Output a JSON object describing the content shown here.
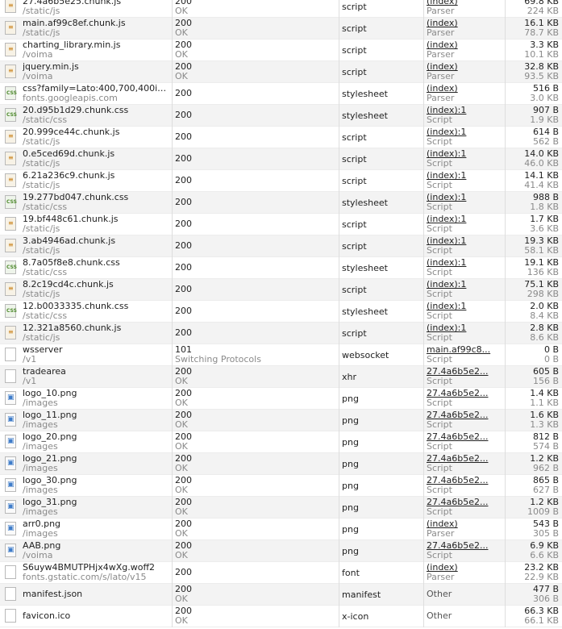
{
  "rows": [
    {
      "name": "27.4a6b5e25.chunk.js",
      "path": "/static/js",
      "status": "200",
      "status_text": "OK",
      "type": "script",
      "initiator": "(index)",
      "initiator_sub": "Parser",
      "size": "69.8 KB",
      "size_sub": "224 KB",
      "icon": "script-file-icon"
    },
    {
      "name": "main.af99c8ef.chunk.js",
      "path": "/static/js",
      "status": "200",
      "status_text": "OK",
      "type": "script",
      "initiator": "(index)",
      "initiator_sub": "Parser",
      "size": "16.1 KB",
      "size_sub": "78.7 KB",
      "icon": "script-file-icon"
    },
    {
      "name": "charting_library.min.js",
      "path": "/voima",
      "status": "200",
      "status_text": "OK",
      "type": "script",
      "initiator": "(index)",
      "initiator_sub": "Parser",
      "size": "3.3 KB",
      "size_sub": "10.1 KB",
      "icon": "script-file-icon"
    },
    {
      "name": "jquery.min.js",
      "path": "/voima",
      "status": "200",
      "status_text": "OK",
      "type": "script",
      "initiator": "(index)",
      "initiator_sub": "Parser",
      "size": "32.8 KB",
      "size_sub": "93.5 KB",
      "icon": "script-file-icon"
    },
    {
      "name": "css?family=Lato:400,700,400itali...",
      "path": "fonts.googleapis.com",
      "status": "200",
      "status_text": "",
      "type": "stylesheet",
      "initiator": "(index)",
      "initiator_sub": "Parser",
      "size": "516 B",
      "size_sub": "3.0 KB",
      "icon": "css-file-icon"
    },
    {
      "name": "20.d95b1d29.chunk.css",
      "path": "/static/css",
      "status": "200",
      "status_text": "",
      "type": "stylesheet",
      "initiator": "(index):1",
      "initiator_sub": "Script",
      "size": "907 B",
      "size_sub": "1.9 KB",
      "icon": "css-file-icon"
    },
    {
      "name": "20.999ce44c.chunk.js",
      "path": "/static/js",
      "status": "200",
      "status_text": "",
      "type": "script",
      "initiator": "(index):1",
      "initiator_sub": "Script",
      "size": "614 B",
      "size_sub": "562 B",
      "icon": "script-file-icon"
    },
    {
      "name": "0.e5ced69d.chunk.js",
      "path": "/static/js",
      "status": "200",
      "status_text": "",
      "type": "script",
      "initiator": "(index):1",
      "initiator_sub": "Script",
      "size": "14.0 KB",
      "size_sub": "46.0 KB",
      "icon": "script-file-icon"
    },
    {
      "name": "6.21a236c9.chunk.js",
      "path": "/static/js",
      "status": "200",
      "status_text": "",
      "type": "script",
      "initiator": "(index):1",
      "initiator_sub": "Script",
      "size": "14.1 KB",
      "size_sub": "41.4 KB",
      "icon": "script-file-icon"
    },
    {
      "name": "19.277bd047.chunk.css",
      "path": "/static/css",
      "status": "200",
      "status_text": "",
      "type": "stylesheet",
      "initiator": "(index):1",
      "initiator_sub": "Script",
      "size": "988 B",
      "size_sub": "1.8 KB",
      "icon": "css-file-icon"
    },
    {
      "name": "19.bf448c61.chunk.js",
      "path": "/static/js",
      "status": "200",
      "status_text": "",
      "type": "script",
      "initiator": "(index):1",
      "initiator_sub": "Script",
      "size": "1.7 KB",
      "size_sub": "3.6 KB",
      "icon": "script-file-icon"
    },
    {
      "name": "3.ab4946ad.chunk.js",
      "path": "/static/js",
      "status": "200",
      "status_text": "",
      "type": "script",
      "initiator": "(index):1",
      "initiator_sub": "Script",
      "size": "19.3 KB",
      "size_sub": "58.1 KB",
      "icon": "script-file-icon"
    },
    {
      "name": "8.7a05f8e8.chunk.css",
      "path": "/static/css",
      "status": "200",
      "status_text": "",
      "type": "stylesheet",
      "initiator": "(index):1",
      "initiator_sub": "Script",
      "size": "19.1 KB",
      "size_sub": "136 KB",
      "icon": "css-file-icon"
    },
    {
      "name": "8.2c19cd4c.chunk.js",
      "path": "/static/js",
      "status": "200",
      "status_text": "",
      "type": "script",
      "initiator": "(index):1",
      "initiator_sub": "Script",
      "size": "75.1 KB",
      "size_sub": "298 KB",
      "icon": "script-file-icon"
    },
    {
      "name": "12.b0033335.chunk.css",
      "path": "/static/css",
      "status": "200",
      "status_text": "",
      "type": "stylesheet",
      "initiator": "(index):1",
      "initiator_sub": "Script",
      "size": "2.0 KB",
      "size_sub": "8.4 KB",
      "icon": "css-file-icon"
    },
    {
      "name": "12.321a8560.chunk.js",
      "path": "/static/js",
      "status": "200",
      "status_text": "",
      "type": "script",
      "initiator": "(index):1",
      "initiator_sub": "Script",
      "size": "2.8 KB",
      "size_sub": "8.6 KB",
      "icon": "script-file-icon"
    },
    {
      "name": "wsserver",
      "path": "/v1",
      "status": "101",
      "status_text": "Switching Protocols",
      "type": "websocket",
      "initiator": "main.af99c8...",
      "initiator_sub": "Script",
      "size": "0 B",
      "size_sub": "0 B",
      "icon": "blank-file-icon"
    },
    {
      "name": "tradearea",
      "path": "/v1",
      "status": "200",
      "status_text": "OK",
      "type": "xhr",
      "initiator": "27.4a6b5e2...",
      "initiator_sub": "Script",
      "size": "605 B",
      "size_sub": "156 B",
      "icon": "blank-file-icon"
    },
    {
      "name": "logo_10.png",
      "path": "/images",
      "status": "200",
      "status_text": "OK",
      "type": "png",
      "initiator": "27.4a6b5e2...",
      "initiator_sub": "Script",
      "size": "1.4 KB",
      "size_sub": "1.1 KB",
      "icon": "image-file-icon"
    },
    {
      "name": "logo_11.png",
      "path": "/images",
      "status": "200",
      "status_text": "OK",
      "type": "png",
      "initiator": "27.4a6b5e2...",
      "initiator_sub": "Script",
      "size": "1.6 KB",
      "size_sub": "1.3 KB",
      "icon": "image-file-icon"
    },
    {
      "name": "logo_20.png",
      "path": "/images",
      "status": "200",
      "status_text": "OK",
      "type": "png",
      "initiator": "27.4a6b5e2...",
      "initiator_sub": "Script",
      "size": "812 B",
      "size_sub": "574 B",
      "icon": "image-file-icon"
    },
    {
      "name": "logo_21.png",
      "path": "/images",
      "status": "200",
      "status_text": "OK",
      "type": "png",
      "initiator": "27.4a6b5e2...",
      "initiator_sub": "Script",
      "size": "1.2 KB",
      "size_sub": "962 B",
      "icon": "image-file-icon"
    },
    {
      "name": "logo_30.png",
      "path": "/images",
      "status": "200",
      "status_text": "OK",
      "type": "png",
      "initiator": "27.4a6b5e2...",
      "initiator_sub": "Script",
      "size": "865 B",
      "size_sub": "627 B",
      "icon": "image-file-icon"
    },
    {
      "name": "logo_31.png",
      "path": "/images",
      "status": "200",
      "status_text": "OK",
      "type": "png",
      "initiator": "27.4a6b5e2...",
      "initiator_sub": "Script",
      "size": "1.2 KB",
      "size_sub": "1009 B",
      "icon": "image-file-icon"
    },
    {
      "name": "arr0.png",
      "path": "/images",
      "status": "200",
      "status_text": "OK",
      "type": "png",
      "initiator": "(index)",
      "initiator_sub": "Parser",
      "size": "543 B",
      "size_sub": "305 B",
      "icon": "image-file-icon"
    },
    {
      "name": "AAB.png",
      "path": "/voima",
      "status": "200",
      "status_text": "OK",
      "type": "png",
      "initiator": "27.4a6b5e2...",
      "initiator_sub": "Script",
      "size": "6.9 KB",
      "size_sub": "6.6 KB",
      "icon": "image-file-icon"
    },
    {
      "name": "S6uyw4BMUTPHjx4wXg.woff2",
      "path": "fonts.gstatic.com/s/lato/v15",
      "status": "200",
      "status_text": "",
      "type": "font",
      "initiator": "(index)",
      "initiator_sub": "Parser",
      "size": "23.2 KB",
      "size_sub": "22.9 KB",
      "icon": "blank-file-icon"
    },
    {
      "name": "manifest.json",
      "path": "",
      "status": "200",
      "status_text": "OK",
      "type": "manifest",
      "initiator": "Other",
      "initiator_sub": "",
      "size": "477 B",
      "size_sub": "306 B",
      "icon": "blank-file-icon"
    },
    {
      "name": "favicon.ico",
      "path": "",
      "status": "200",
      "status_text": "OK",
      "type": "x-icon",
      "initiator": "Other",
      "initiator_sub": "",
      "size": "66.3 KB",
      "size_sub": "66.1 KB",
      "icon": "blank-file-icon"
    }
  ]
}
